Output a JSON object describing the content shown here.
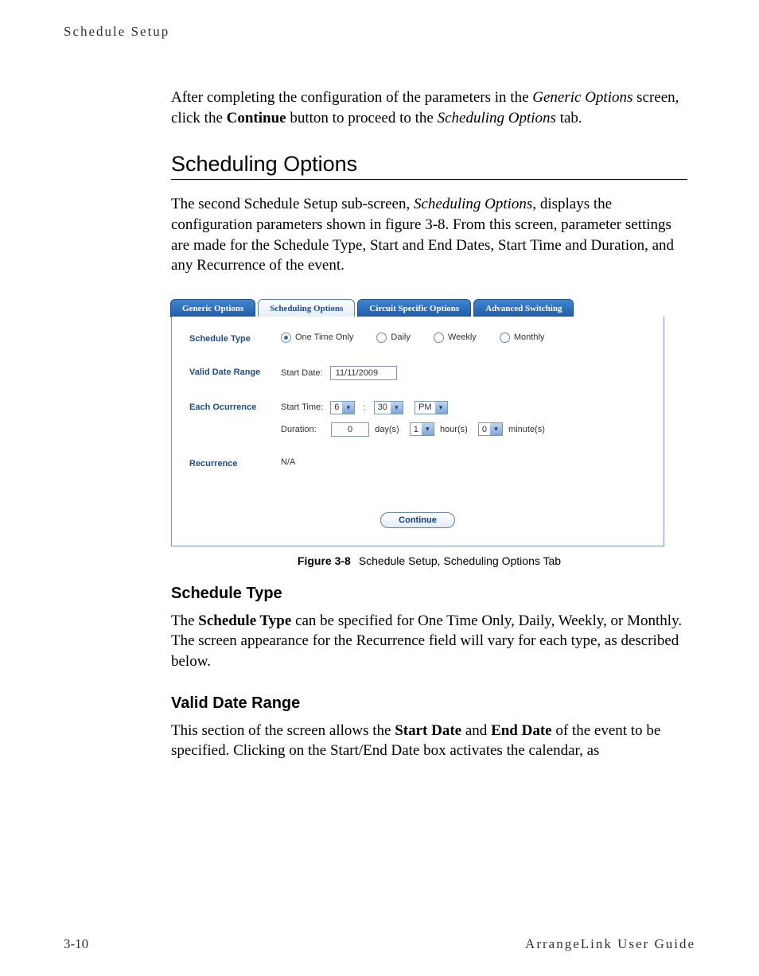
{
  "header": {
    "running": "Schedule Setup"
  },
  "intro": {
    "p1_a": "After completing the configuration of the parameters in the ",
    "p1_b": "Generic Options",
    "p1_c": " screen, click the ",
    "p1_d": "Continue",
    "p1_e": " button to proceed to the ",
    "p1_f": "Scheduling Options",
    "p1_g": " tab."
  },
  "section": {
    "title": "Scheduling Options",
    "para_a": "The second Schedule Setup sub-screen, ",
    "para_b": "Scheduling Options",
    "para_c": ", displays the configuration parameters shown in figure 3-8. From this screen, parameter settings are made for the Schedule Type, Start and End Dates, Start Time and Duration, and any Recurrence of the event."
  },
  "screenshot": {
    "tabs": {
      "generic": "Generic Options",
      "scheduling": "Scheduling Options",
      "circuit": "Circuit Specific Options",
      "advanced": "Advanced Switching"
    },
    "rows": {
      "schedule_type": {
        "label": "Schedule Type",
        "opts": {
          "one_time": "One Time Only",
          "daily": "Daily",
          "weekly": "Weekly",
          "monthly": "Monthly"
        }
      },
      "valid_date_range": {
        "label": "Valid Date Range",
        "start_date_label": "Start Date:",
        "start_date_value": "11/11/2009"
      },
      "each_occurrence": {
        "label": "Each Ocurrence",
        "start_time_label": "Start Time:",
        "hour": "6",
        "colon": ":",
        "minute": "30",
        "ampm": "PM",
        "duration_label": "Duration:",
        "days_val": "0",
        "days_unit": "day(s)",
        "hours_val": "1",
        "hours_unit": "hour(s)",
        "minutes_val": "0",
        "minutes_unit": "minute(s)"
      },
      "recurrence": {
        "label": "Recurrence",
        "value": "N/A"
      }
    },
    "continue": "Continue"
  },
  "figure": {
    "num": "Figure 3-8",
    "caption": "Schedule Setup, Scheduling Options Tab"
  },
  "sub1": {
    "title": "Schedule Type",
    "a": "The ",
    "b": "Schedule Type",
    "c": " can be specified for One Time Only, Daily, Weekly, or Monthly. The screen appearance for the Recurrence field will vary for each type, as described below."
  },
  "sub2": {
    "title": "Valid Date Range",
    "a": "This section of the screen allows the ",
    "b": "Start Date",
    "c": " and ",
    "d": "End Date",
    "e": " of the event to be specified. Clicking on the Start/End Date box activates the calendar, as"
  },
  "footer": {
    "page": "3-10",
    "guide": "ArrangeLink User Guide"
  }
}
